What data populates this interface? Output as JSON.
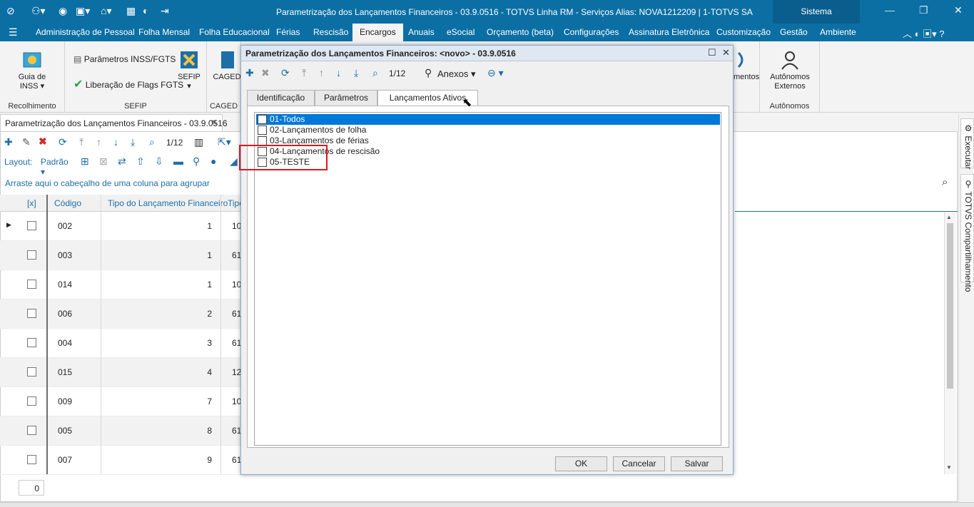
{
  "window": {
    "title": "Parametrização dos Lançamentos Financeiros - 03.9.0516 - TOTVS Linha RM - Serviços  Alias: NOVA1212209 | 1-TOTVS SA",
    "sistema": "Sistema",
    "minimize": "—",
    "restore": "❐",
    "close": "✕"
  },
  "menu": {
    "items": [
      "Administração de Pessoal",
      "Folha Mensal",
      "Folha Educacional",
      "Férias",
      "Rescisão",
      "Encargos",
      "Anuais",
      "eSocial",
      "Orçamento (beta)",
      "Configurações",
      "Assinatura Eletrônica",
      "Customização",
      "Gestão",
      "Ambiente"
    ],
    "active": "Encargos"
  },
  "ribbon": {
    "guia_inss": "Guia de INSS",
    "recolhimento": "Recolhimento",
    "parametros_inss": "Parâmetros INSS/FGTS",
    "liberacao_flags": "Liberação de Flags FGTS",
    "sefip_btn": "SEFIP",
    "sefip_group": "SEFIP",
    "caged_btn": "CAGED",
    "caged_group": "CAGED",
    "mentos_btn": "mentos",
    "autonomos_btn": "Autônomos Externos",
    "autonomos_group": "Autônomos"
  },
  "doc_tab": {
    "label": "Parametrização dos Lançamentos Financeiros - 03.9.0516",
    "close": "✕"
  },
  "toolbar": {
    "page": "1/12",
    "layout_label": "Layout:",
    "layout_value": "Padrão"
  },
  "grid": {
    "group_hint": "Arraste aqui o cabeçalho de uma coluna para agrupar",
    "headers": {
      "check": "[x]",
      "codigo": "Código",
      "tipo": "Tipo do Lançamento Financeiro",
      "tipo2": "Tipo"
    },
    "rows": [
      {
        "codigo": "002",
        "tipo": "1",
        "tipo2": "10"
      },
      {
        "codigo": "003",
        "tipo": "1",
        "tipo2": "61"
      },
      {
        "codigo": "014",
        "tipo": "1",
        "tipo2": "10"
      },
      {
        "codigo": "006",
        "tipo": "2",
        "tipo2": "61"
      },
      {
        "codigo": "004",
        "tipo": "3",
        "tipo2": "61"
      },
      {
        "codigo": "015",
        "tipo": "4",
        "tipo2": "12"
      },
      {
        "codigo": "009",
        "tipo": "7",
        "tipo2": "10"
      },
      {
        "codigo": "005",
        "tipo": "8",
        "tipo2": "61"
      },
      {
        "codigo": "007",
        "tipo": "9",
        "tipo2": "61"
      }
    ],
    "footer_count": "0"
  },
  "side": {
    "executar": "Executar",
    "totvs_share": "TOTVS Compartilhamento"
  },
  "dialog": {
    "title": "Parametrização dos Lançamentos Financeiros: <novo> - 03.9.0516",
    "page": "1/12",
    "anexos": "Anexos",
    "tabs": [
      "Identificação",
      "Parâmetros",
      "Lançamentos Ativos"
    ],
    "selected_tab": "Lançamentos Ativos",
    "list": [
      "01-Todos",
      "02-Lançamentos de folha",
      "03-Lançamentos de férias",
      "04-Lançamentos de rescisão",
      "05-TESTE"
    ],
    "buttons": {
      "ok": "OK",
      "cancel": "Cancelar",
      "save": "Salvar"
    }
  },
  "colors": {
    "brand": "#0b6fa4",
    "selection": "#0078d7",
    "highlight": "#e0151c"
  }
}
